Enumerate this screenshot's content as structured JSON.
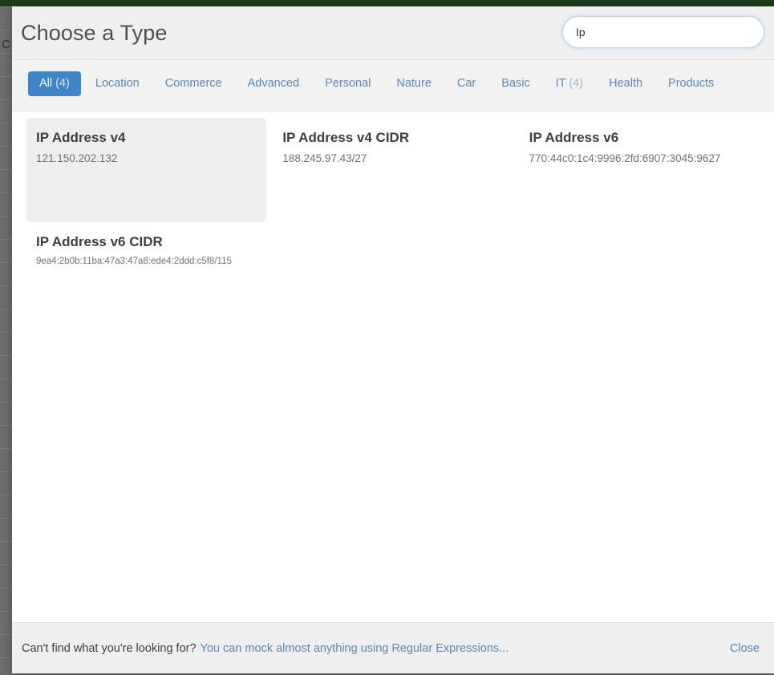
{
  "background": {
    "topbar_color": "#1d3b1d",
    "strip_color": "#6e6e6e",
    "edge_glyph": "C"
  },
  "modal": {
    "title": "Choose a Type",
    "search": {
      "value": "Ip",
      "placeholder": ""
    },
    "tabs": [
      {
        "label": "All",
        "count": "(4)",
        "active": true
      },
      {
        "label": "Location",
        "count": "",
        "active": false
      },
      {
        "label": "Commerce",
        "count": "",
        "active": false
      },
      {
        "label": "Advanced",
        "count": "",
        "active": false
      },
      {
        "label": "Personal",
        "count": "",
        "active": false
      },
      {
        "label": "Nature",
        "count": "",
        "active": false
      },
      {
        "label": "Car",
        "count": "",
        "active": false
      },
      {
        "label": "Basic",
        "count": "",
        "active": false
      },
      {
        "label": "IT",
        "count": "(4)",
        "active": false
      },
      {
        "label": "Health",
        "count": "",
        "active": false
      },
      {
        "label": "Products",
        "count": "",
        "active": false
      }
    ],
    "results": [
      {
        "title": "IP Address v4",
        "sample": "121.150.202.132",
        "selected": true,
        "small": false
      },
      {
        "title": "IP Address v4 CIDR",
        "sample": "188.245.97.43/27",
        "selected": false,
        "small": false
      },
      {
        "title": "IP Address v6",
        "sample": "770:44c0:1c4:9996:2fd:6907:3045:9627",
        "selected": false,
        "small": false
      },
      {
        "title": "IP Address v6 CIDR",
        "sample": "9ea4:2b0b:11ba:47a3:47a8:ede4:2ddd:c5f8/115",
        "selected": false,
        "small": true
      }
    ],
    "footer": {
      "prompt": "Can't find what you're looking for?",
      "link": "You can mock almost anything using Regular Expressions...",
      "close": "Close"
    },
    "colors": {
      "accent": "#3f86c9",
      "link": "#5b87bd",
      "selected_card": "#eeeeee"
    }
  }
}
